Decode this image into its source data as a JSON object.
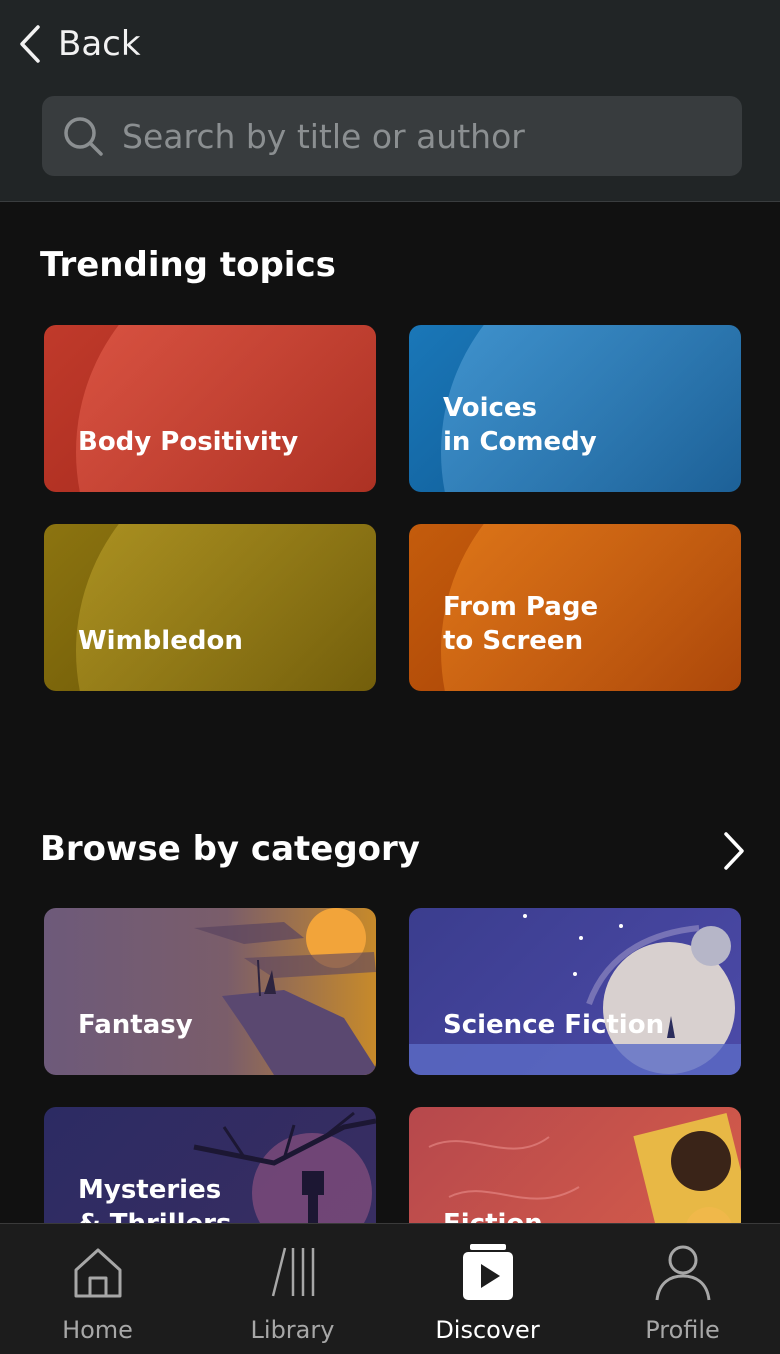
{
  "header": {
    "back_label": "Back",
    "search_placeholder": "Search by title or author"
  },
  "trending": {
    "title": "Trending topics",
    "tiles": [
      {
        "label": "Body Positivity",
        "color": "#b8311f"
      },
      {
        "label": "Voices\nin Comedy",
        "color": "#0f62a0"
      },
      {
        "label": "Wimbledon",
        "color": "#7a6206"
      },
      {
        "label": "From Page\nto Screen",
        "color": "#b34a08"
      }
    ]
  },
  "browse": {
    "title": "Browse by category",
    "categories": [
      {
        "label": "Fantasy"
      },
      {
        "label": "Science Fiction"
      },
      {
        "label": "Mysteries\n& Thrillers"
      },
      {
        "label": "Fiction"
      }
    ]
  },
  "nav": {
    "active": "Discover",
    "items": [
      {
        "label": "Home",
        "icon": "home-icon"
      },
      {
        "label": "Library",
        "icon": "library-icon"
      },
      {
        "label": "Discover",
        "icon": "discover-icon"
      },
      {
        "label": "Profile",
        "icon": "profile-icon"
      }
    ]
  }
}
